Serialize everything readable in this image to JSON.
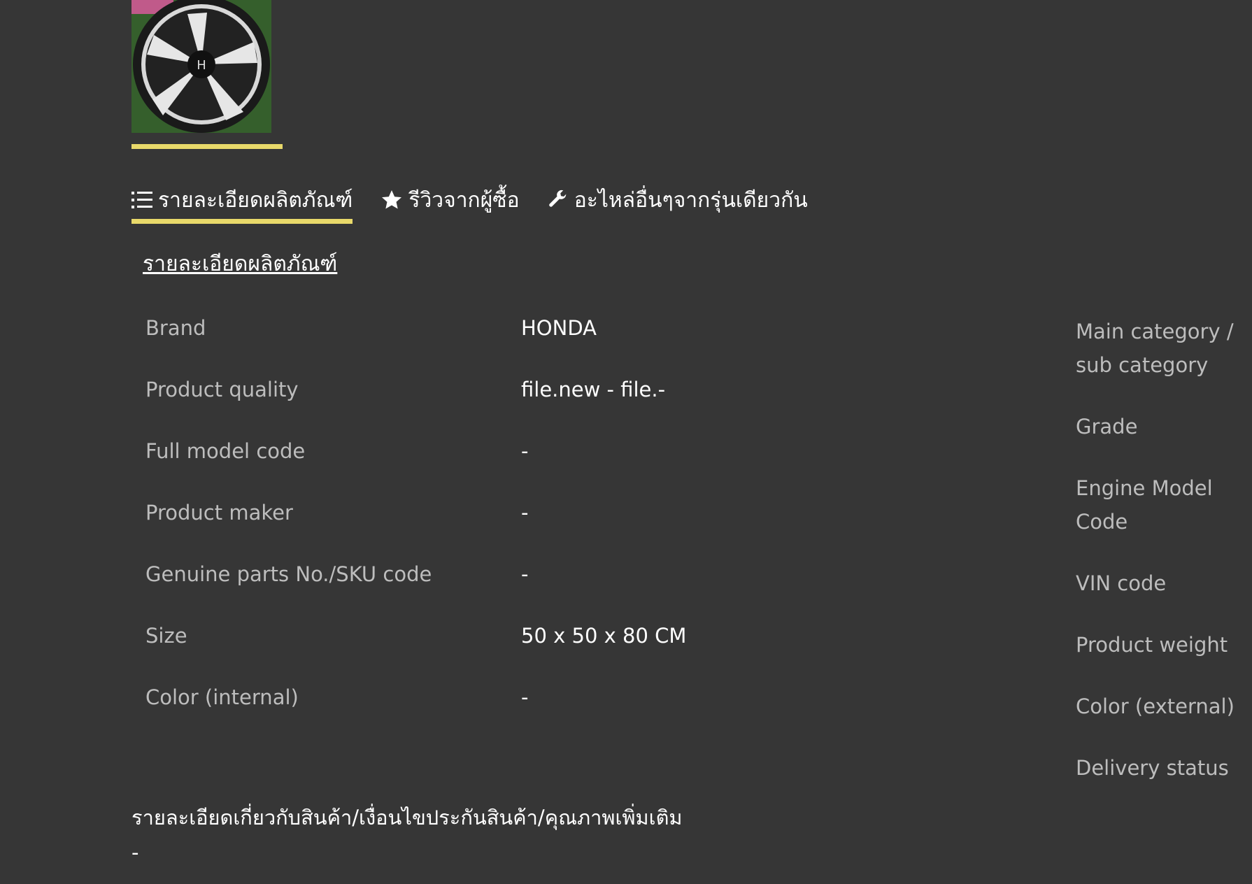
{
  "thumbnail": {
    "alt": "HONDA wheel"
  },
  "tabs": [
    {
      "label": "รายละเอียดผลิตภัณฑ์",
      "icon": "list-icon",
      "active": true
    },
    {
      "label": "รีวิวจากผู้ซื้อ",
      "icon": "star-icon",
      "active": false
    },
    {
      "label": "อะไหล่อื่นๆจากรุ่นเดียวกัน",
      "icon": "wrench-icon",
      "active": false
    }
  ],
  "section_title": "รายละเอียดผลิตภัณฑ์",
  "specs_left": [
    {
      "label": "Brand",
      "value": "HONDA"
    },
    {
      "label": "Product quality",
      "value": "file.new - file.-"
    },
    {
      "label": "Full model code",
      "value": "-"
    },
    {
      "label": "Product maker",
      "value": "-"
    },
    {
      "label": "Genuine parts No./SKU code",
      "value": "-"
    },
    {
      "label": "Size",
      "value": "50 x 50 x 80 CM"
    },
    {
      "label": "Color (internal)",
      "value": "-"
    }
  ],
  "specs_right": [
    {
      "label": "Main category / sub category"
    },
    {
      "label": "Grade"
    },
    {
      "label": "Engine Model Code"
    },
    {
      "label": "VIN code"
    },
    {
      "label": "Product weight"
    },
    {
      "label": "Color (external)"
    },
    {
      "label": "Delivery status"
    }
  ],
  "footer": {
    "title": "รายละเอียดเกี่ยวกับสินค้า/เงื่อนไขประกันสินค้า/คุณภาพเพิ่มเติม",
    "value": "-"
  },
  "colors": {
    "background": "#363636",
    "accent": "#e9d96a",
    "label": "#bdbdbd",
    "value": "#ffffff"
  }
}
